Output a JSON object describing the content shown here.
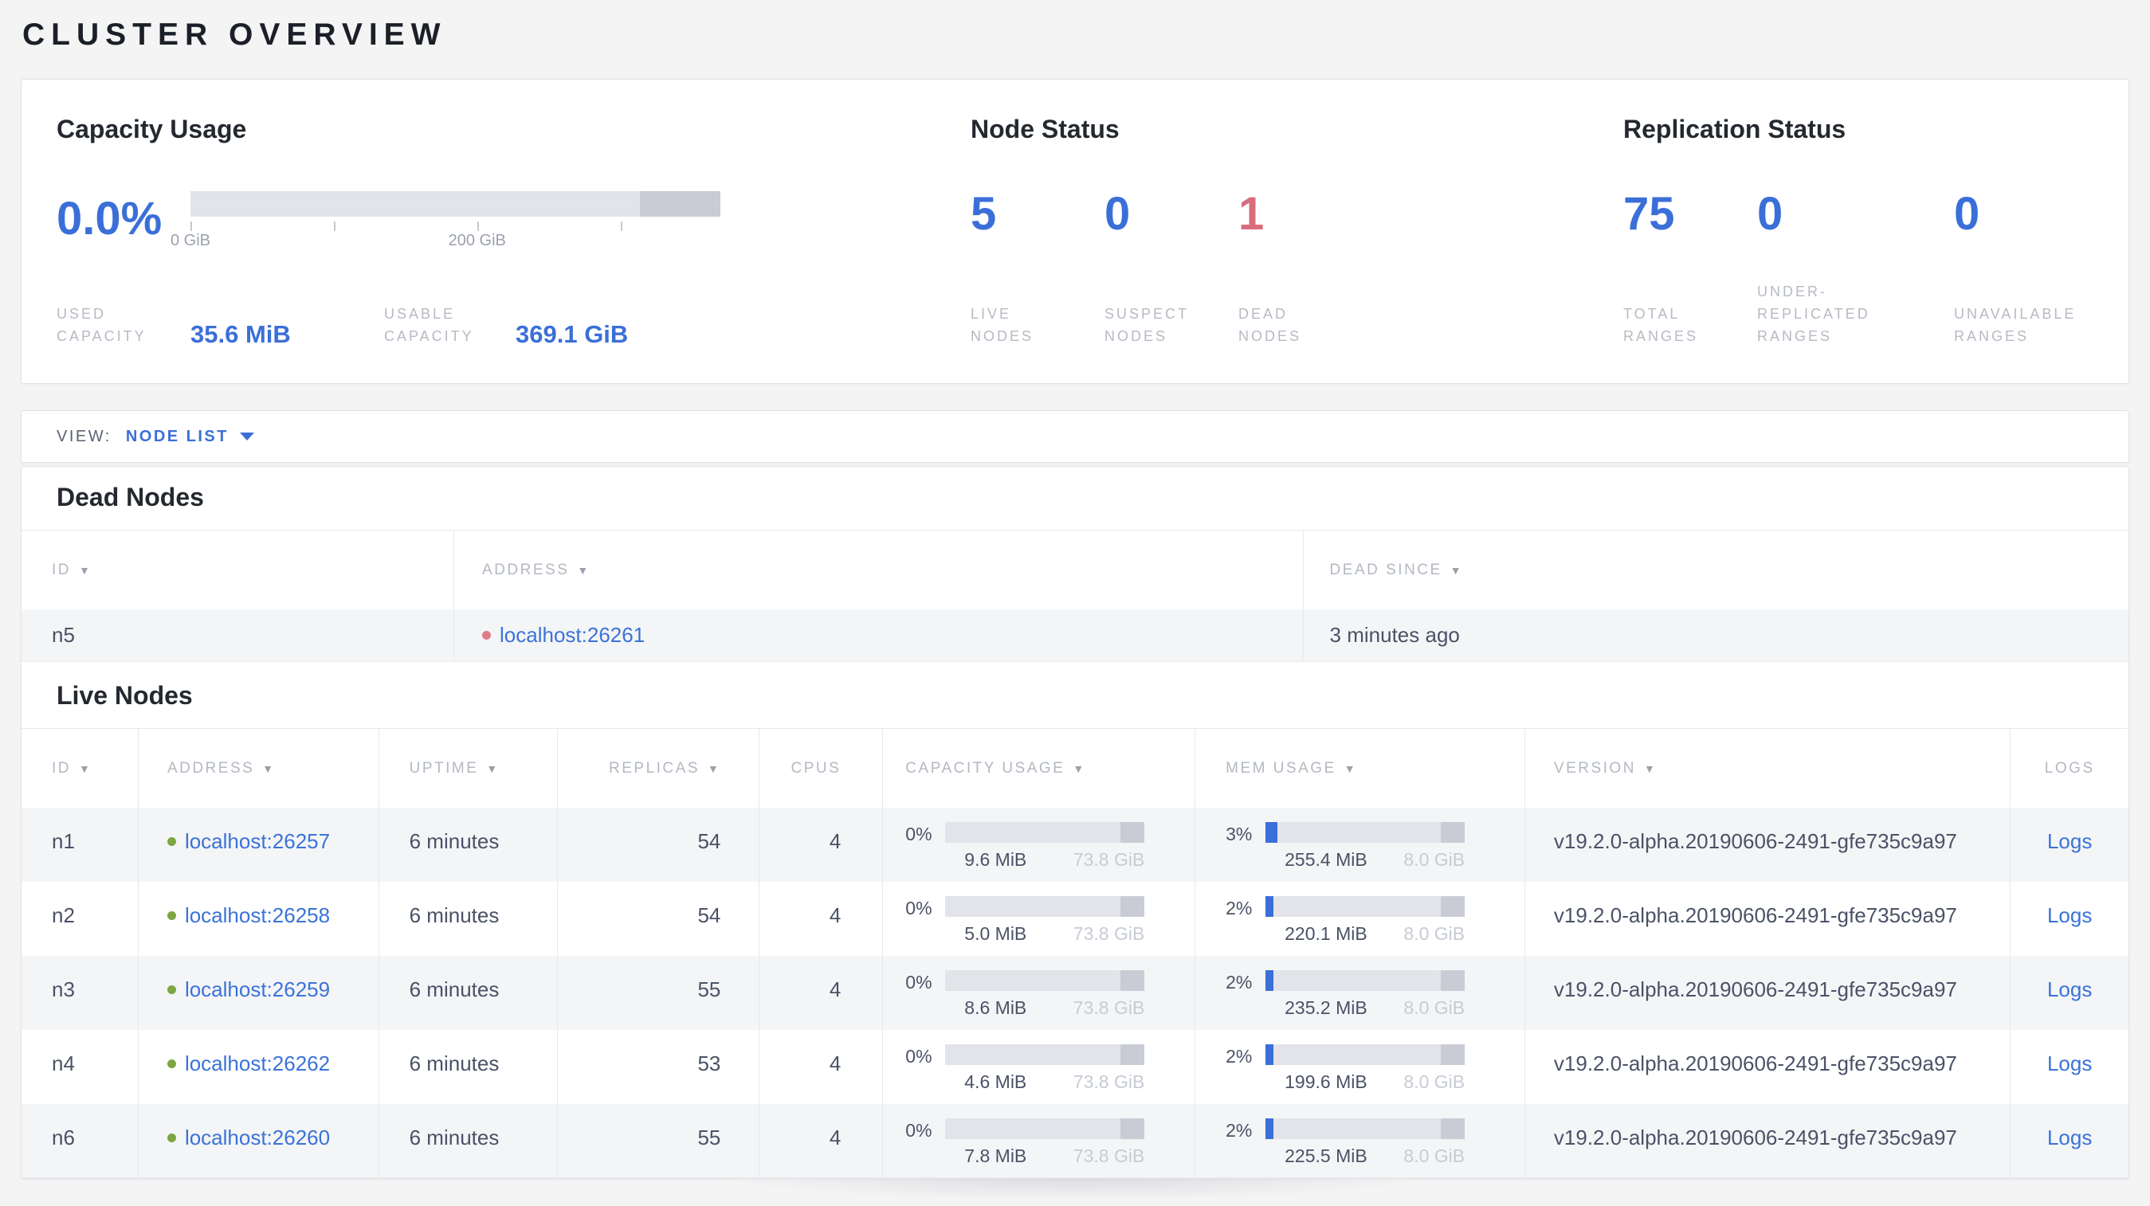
{
  "page_title": "CLUSTER OVERVIEW",
  "colors": {
    "blue": "#3b6fd8",
    "link": "#3a73d8",
    "red": "#d96d7d",
    "red_dot": "#dd7d88",
    "green_dot": "#7ca63f"
  },
  "icons": {
    "sort_arrow_icon": "▼",
    "dropdown_caret_icon": "▼"
  },
  "overview": {
    "capacity": {
      "title": "Capacity Usage",
      "percent": "0.0%",
      "bar": {
        "used_pct": 0,
        "other_pct": 15.2
      },
      "axis_ticks": [
        {
          "pos": 0,
          "label": "0 GiB"
        },
        {
          "pos": 27.1,
          "label": ""
        },
        {
          "pos": 54.1,
          "label": "200 GiB"
        },
        {
          "pos": 81.2,
          "label": ""
        }
      ],
      "stats": [
        {
          "label_lines": [
            "USED",
            "CAPACITY"
          ],
          "value": "35.6 MiB"
        },
        {
          "label_lines": [
            "USABLE",
            "CAPACITY"
          ],
          "value": "369.1 GiB"
        }
      ]
    },
    "node_status": {
      "title": "Node Status",
      "stats": [
        {
          "value": "5",
          "color": "blue",
          "label_lines": [
            "LIVE",
            "NODES"
          ]
        },
        {
          "value": "0",
          "color": "blue",
          "label_lines": [
            "SUSPECT",
            "NODES"
          ]
        },
        {
          "value": "1",
          "color": "red",
          "label_lines": [
            "DEAD",
            "NODES"
          ]
        }
      ]
    },
    "replication": {
      "title": "Replication Status",
      "stats": [
        {
          "value": "75",
          "color": "blue",
          "label_lines": [
            "TOTAL",
            "RANGES"
          ]
        },
        {
          "value": "0",
          "color": "blue",
          "label_lines": [
            "UNDER-",
            "REPLICATED",
            "RANGES"
          ]
        },
        {
          "value": "0",
          "color": "blue",
          "label_lines": [
            "UNAVAILABLE",
            "RANGES"
          ]
        }
      ]
    }
  },
  "view_bar": {
    "label": "VIEW:",
    "selected": "NODE LIST"
  },
  "dead_nodes": {
    "title": "Dead Nodes",
    "columns": [
      {
        "key": "id",
        "label": "ID",
        "sortable": true
      },
      {
        "key": "address",
        "label": "ADDRESS",
        "sortable": true
      },
      {
        "key": "dead_since",
        "label": "DEAD SINCE",
        "sortable": true
      }
    ],
    "rows": [
      {
        "id": "n5",
        "address": "localhost:26261",
        "dead_since": "3 minutes ago"
      }
    ]
  },
  "live_nodes": {
    "title": "Live Nodes",
    "columns": [
      {
        "key": "id",
        "label": "ID",
        "sortable": true
      },
      {
        "key": "address",
        "label": "ADDRESS",
        "sortable": true
      },
      {
        "key": "uptime",
        "label": "UPTIME",
        "sortable": true
      },
      {
        "key": "replicas",
        "label": "REPLICAS",
        "sortable": true
      },
      {
        "key": "cpus",
        "label": "CPUS",
        "sortable": false
      },
      {
        "key": "capacity",
        "label": "CAPACITY USAGE",
        "sortable": true
      },
      {
        "key": "memory",
        "label": "MEM USAGE",
        "sortable": true
      },
      {
        "key": "version",
        "label": "VERSION",
        "sortable": true
      },
      {
        "key": "logs",
        "label": "LOGS",
        "sortable": false
      }
    ],
    "rows": [
      {
        "id": "n1",
        "address": "localhost:26257",
        "uptime": "6 minutes",
        "replicas": "54",
        "cpus": "4",
        "capacity": {
          "percent": "0%",
          "pct": 0,
          "other_pct": 12,
          "used": "9.6 MiB",
          "total": "73.8 GiB"
        },
        "memory": {
          "percent": "3%",
          "pct": 3,
          "other_pct": 12,
          "used": "255.4 MiB",
          "total": "8.0 GiB"
        },
        "version": "v19.2.0-alpha.20190606-2491-gfe735c9a97",
        "logs": "Logs"
      },
      {
        "id": "n2",
        "address": "localhost:26258",
        "uptime": "6 minutes",
        "replicas": "54",
        "cpus": "4",
        "capacity": {
          "percent": "0%",
          "pct": 0,
          "other_pct": 12,
          "used": "5.0 MiB",
          "total": "73.8 GiB"
        },
        "memory": {
          "percent": "2%",
          "pct": 2,
          "other_pct": 12,
          "used": "220.1 MiB",
          "total": "8.0 GiB"
        },
        "version": "v19.2.0-alpha.20190606-2491-gfe735c9a97",
        "logs": "Logs"
      },
      {
        "id": "n3",
        "address": "localhost:26259",
        "uptime": "6 minutes",
        "replicas": "55",
        "cpus": "4",
        "capacity": {
          "percent": "0%",
          "pct": 0,
          "other_pct": 12,
          "used": "8.6 MiB",
          "total": "73.8 GiB"
        },
        "memory": {
          "percent": "2%",
          "pct": 2,
          "other_pct": 12,
          "used": "235.2 MiB",
          "total": "8.0 GiB"
        },
        "version": "v19.2.0-alpha.20190606-2491-gfe735c9a97",
        "logs": "Logs"
      },
      {
        "id": "n4",
        "address": "localhost:26262",
        "uptime": "6 minutes",
        "replicas": "53",
        "cpus": "4",
        "capacity": {
          "percent": "0%",
          "pct": 0,
          "other_pct": 12,
          "used": "4.6 MiB",
          "total": "73.8 GiB"
        },
        "memory": {
          "percent": "2%",
          "pct": 2,
          "other_pct": 12,
          "used": "199.6 MiB",
          "total": "8.0 GiB"
        },
        "version": "v19.2.0-alpha.20190606-2491-gfe735c9a97",
        "logs": "Logs"
      },
      {
        "id": "n6",
        "address": "localhost:26260",
        "uptime": "6 minutes",
        "replicas": "55",
        "cpus": "4",
        "capacity": {
          "percent": "0%",
          "pct": 0,
          "other_pct": 12,
          "used": "7.8 MiB",
          "total": "73.8 GiB"
        },
        "memory": {
          "percent": "2%",
          "pct": 2,
          "other_pct": 12,
          "used": "225.5 MiB",
          "total": "8.0 GiB"
        },
        "version": "v19.2.0-alpha.20190606-2491-gfe735c9a97",
        "logs": "Logs"
      }
    ]
  }
}
